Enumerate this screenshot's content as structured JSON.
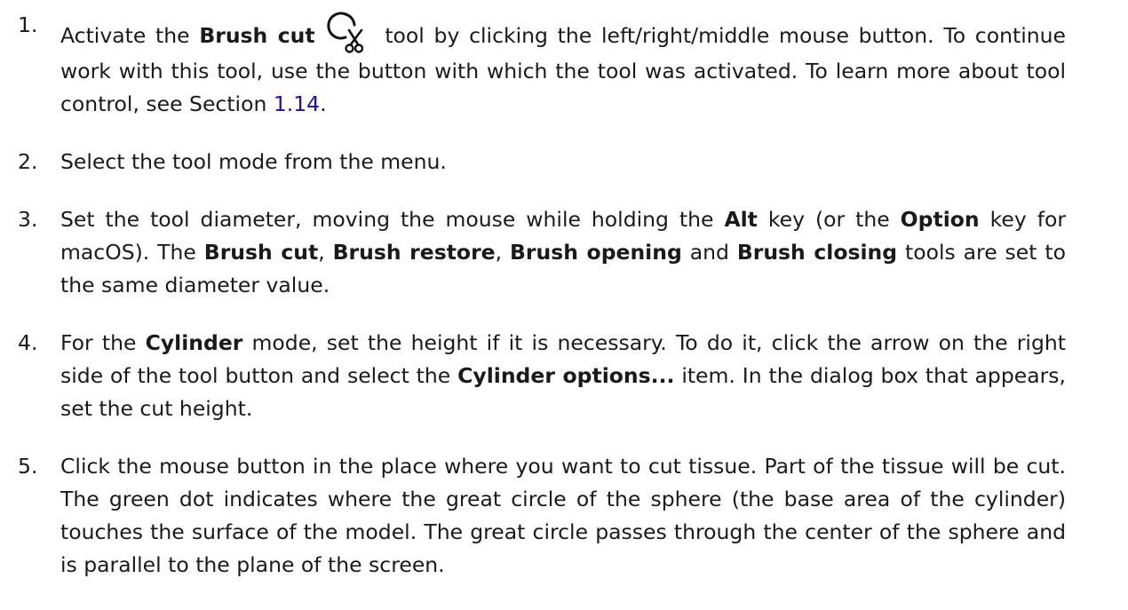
{
  "steps": [
    {
      "number": "1.",
      "t1": "Activate the ",
      "b1": "Brush cut",
      "t2": " tool by clicking the left/right/middle mouse button.  To continue work with this tool, use the button with which the tool was activated. To learn more about tool control, see Section ",
      "link": "1.14",
      "t3": ".",
      "icon": "brush-cut-icon"
    },
    {
      "number": "2.",
      "t1": "Select the tool mode from the menu."
    },
    {
      "number": "3.",
      "t1": "Set the tool diameter, moving the mouse while holding the ",
      "b1": "Alt",
      "t2": " key (or the ",
      "b2": "Option",
      "t3": " key for macOS). The ",
      "b3": "Brush cut",
      "t4": ", ",
      "b4": "Brush restore",
      "t5": ", ",
      "b5": "Brush opening",
      "t6": " and ",
      "b6": "Brush closing",
      "t7": " tools are set to the same diameter value."
    },
    {
      "number": "4.",
      "t1": "For the ",
      "b1": "Cylinder",
      "t2": " mode, set the height if it is necessary.  To do it, click the arrow on the right side of the tool button and select the ",
      "b2": "Cylinder options...",
      "t3": "  item.  In the dialog box that appears, set the cut height."
    },
    {
      "number": "5.",
      "t1": "Click the mouse button in the place where you want to cut tissue.  Part of the tissue will be cut.  The green dot indicates where the great circle of the sphere (the base area of the cylinder) touches the surface of the model.  The great circle passes through the center of the sphere and is parallel to the plane of the screen."
    }
  ],
  "colors": {
    "text": "#1a1a1a",
    "link": "#1a0db1"
  }
}
